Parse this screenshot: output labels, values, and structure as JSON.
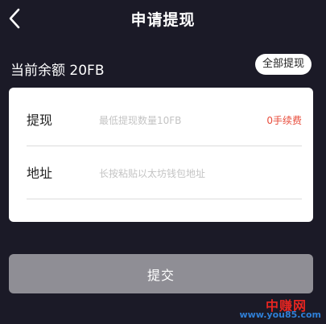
{
  "header": {
    "title": "申请提现"
  },
  "balance": {
    "label": "当前余额 20FB",
    "withdraw_all_label": "全部提现"
  },
  "form": {
    "amount": {
      "label": "提现",
      "placeholder": "最低提现数量10FB",
      "value": "",
      "fee_text": "0手续费"
    },
    "address": {
      "label": "地址",
      "placeholder": "长按粘贴以太坊钱包地址",
      "value": ""
    }
  },
  "submit_label": "提交",
  "watermark": {
    "brand": "中赚网",
    "url": "www.you85.com"
  },
  "colors": {
    "background": "#1b1a27",
    "fee": "#e84b3a",
    "submit_disabled": "#8f8e95"
  },
  "icons": {
    "back": "chevron-left-icon"
  }
}
